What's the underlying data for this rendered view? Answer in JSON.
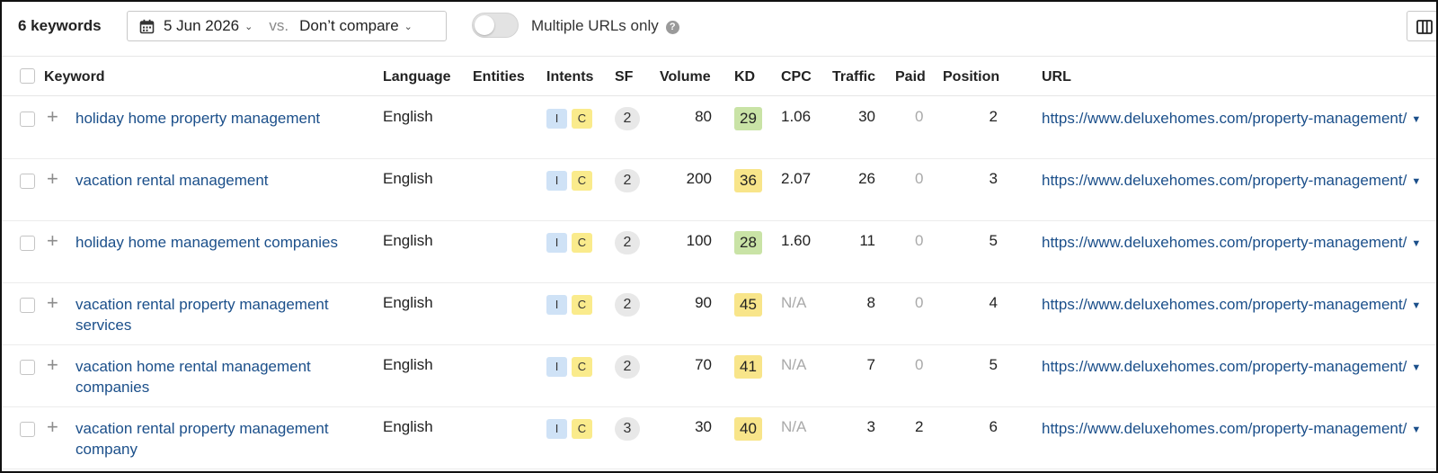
{
  "toolbar": {
    "keyword_count": "6 keywords",
    "date": "5 Jun 2026",
    "vs": "vs.",
    "compare": "Don’t compare",
    "multiple_urls_label": "Multiple URLs only",
    "multiple_urls_on": false,
    "help_glyph": "?"
  },
  "columns": {
    "keyword": "Keyword",
    "language": "Language",
    "entities": "Entities",
    "intents": "Intents",
    "sf": "SF",
    "volume": "Volume",
    "kd": "KD",
    "cpc": "CPC",
    "traffic": "Traffic",
    "paid": "Paid",
    "position": "Position",
    "url": "URL"
  },
  "kd_colors": {
    "easy": "#c9e3a6",
    "medium": "#f8e58a"
  },
  "rows": [
    {
      "keyword": "holiday home property management",
      "language": "English",
      "intent_i": "I",
      "intent_c": "C",
      "sf": "2",
      "volume": "80",
      "kd": "29",
      "kd_level": "easy",
      "cpc": "1.06",
      "cpc_muted": false,
      "traffic": "30",
      "paid": "0",
      "paid_muted": true,
      "position": "2",
      "url": "https://www.deluxehomes.com/property-management/"
    },
    {
      "keyword": "vacation rental management",
      "language": "English",
      "intent_i": "I",
      "intent_c": "C",
      "sf": "2",
      "volume": "200",
      "kd": "36",
      "kd_level": "medium",
      "cpc": "2.07",
      "cpc_muted": false,
      "traffic": "26",
      "paid": "0",
      "paid_muted": true,
      "position": "3",
      "url": "https://www.deluxehomes.com/property-management/"
    },
    {
      "keyword": "holiday home management companies",
      "language": "English",
      "intent_i": "I",
      "intent_c": "C",
      "sf": "2",
      "volume": "100",
      "kd": "28",
      "kd_level": "easy",
      "cpc": "1.60",
      "cpc_muted": false,
      "traffic": "11",
      "paid": "0",
      "paid_muted": true,
      "position": "5",
      "url": "https://www.deluxehomes.com/property-management/"
    },
    {
      "keyword": "vacation rental property management services",
      "language": "English",
      "intent_i": "I",
      "intent_c": "C",
      "sf": "2",
      "volume": "90",
      "kd": "45",
      "kd_level": "medium",
      "cpc": "N/A",
      "cpc_muted": true,
      "traffic": "8",
      "paid": "0",
      "paid_muted": true,
      "position": "4",
      "url": "https://www.deluxehomes.com/property-management/"
    },
    {
      "keyword": "vacation home rental management companies",
      "language": "English",
      "intent_i": "I",
      "intent_c": "C",
      "sf": "2",
      "volume": "70",
      "kd": "41",
      "kd_level": "medium",
      "cpc": "N/A",
      "cpc_muted": true,
      "traffic": "7",
      "paid": "0",
      "paid_muted": true,
      "position": "5",
      "url": "https://www.deluxehomes.com/property-management/"
    },
    {
      "keyword": "vacation rental property management company",
      "language": "English",
      "intent_i": "I",
      "intent_c": "C",
      "sf": "3",
      "volume": "30",
      "kd": "40",
      "kd_level": "medium",
      "cpc": "N/A",
      "cpc_muted": true,
      "traffic": "3",
      "paid": "2",
      "paid_muted": false,
      "position": "6",
      "url": "https://www.deluxehomes.com/property-management/"
    }
  ]
}
